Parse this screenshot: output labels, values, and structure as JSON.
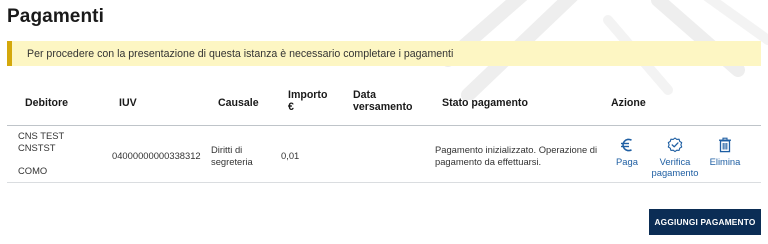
{
  "page": {
    "title": "Pagamenti"
  },
  "alert": {
    "message": "Per procedere con la presentazione di questa istanza è necessario completare i pagamenti"
  },
  "table": {
    "headers": {
      "debitore": "Debitore",
      "iuv": "IUV",
      "causale": "Causale",
      "importo_line1": "Importo",
      "importo_line2": "€",
      "data_line1": "Data",
      "data_line2": "versamento",
      "stato": "Stato pagamento",
      "azione": "Azione"
    },
    "rows": [
      {
        "debitore_line1": "CNS TEST",
        "debitore_line2": "CNSTST",
        "debitore_line3": "COMO",
        "iuv": "04000000000338312",
        "causale_line1": "Diritti di",
        "causale_line2": "segreteria",
        "importo": "0,01",
        "data_versamento": "",
        "stato_line1": "Pagamento inizializzato. Operazione di",
        "stato_line2": "pagamento da effettuarsi.",
        "actions": {
          "paga": {
            "label": "Paga",
            "icon": "euro-icon"
          },
          "verifica": {
            "label_line1": "Verifica",
            "label_line2": "pagamento",
            "icon": "check-badge-icon"
          },
          "elimina": {
            "label": "Elimina",
            "icon": "trash-icon"
          }
        }
      }
    ]
  },
  "buttons": {
    "add_payment": "AGGIUNGI PAGAMENTO"
  },
  "colors": {
    "alert_bg": "#fdf6c3",
    "alert_border": "#d4a80c",
    "link": "#1f5fa3",
    "primary_button": "#0b2d55"
  }
}
